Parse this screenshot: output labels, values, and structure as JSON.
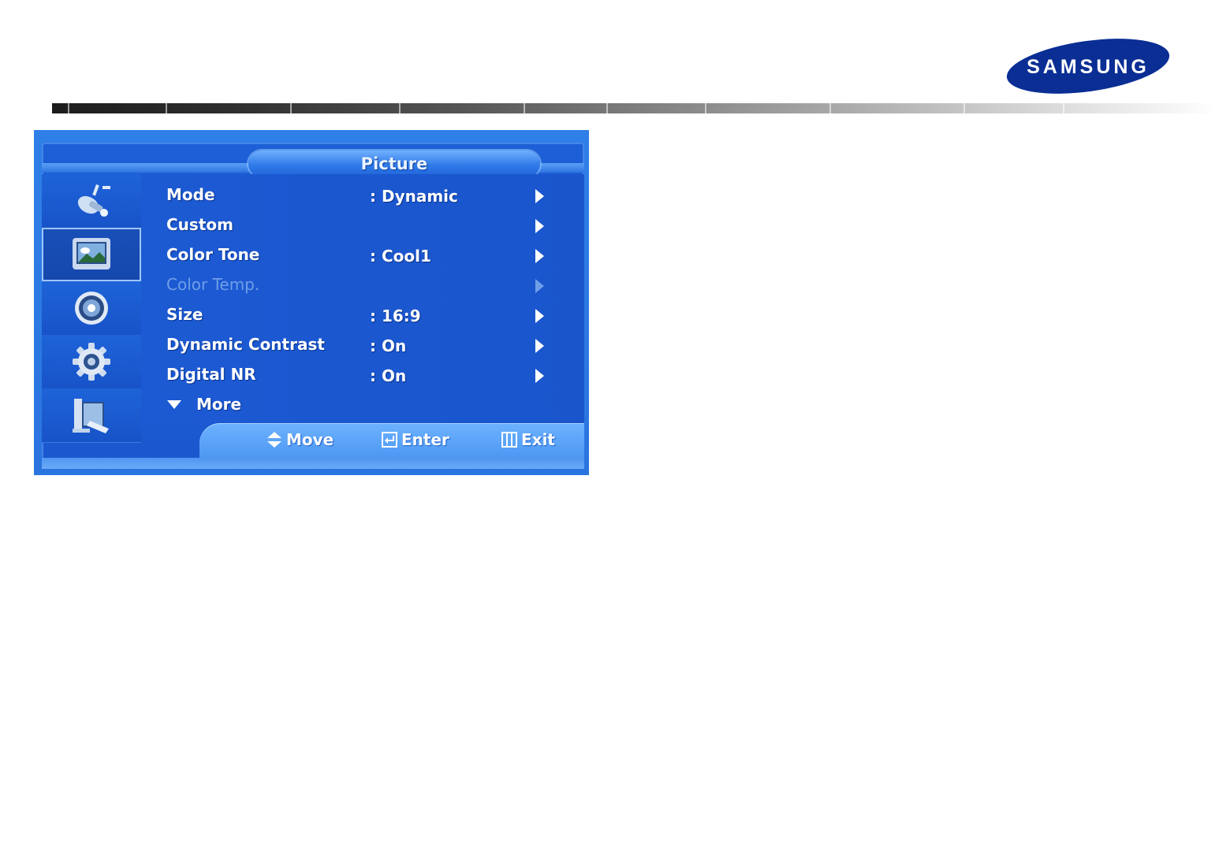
{
  "brand": {
    "logo_text": "SAMSUNG",
    "logo_color": "#0a2e94"
  },
  "osd": {
    "title": "Picture",
    "sidebar": [
      {
        "icon": "input-plug-icon"
      },
      {
        "icon": "picture-icon",
        "active": true
      },
      {
        "icon": "speaker-icon"
      },
      {
        "icon": "gear-icon"
      },
      {
        "icon": "support-icon"
      }
    ],
    "menu": [
      {
        "label": "Mode",
        "value": ": Dynamic",
        "enabled": true
      },
      {
        "label": "Custom",
        "value": "",
        "enabled": true
      },
      {
        "label": "Color Tone",
        "value": ": Cool1",
        "enabled": true
      },
      {
        "label": "Color Temp.",
        "value": "",
        "enabled": false
      },
      {
        "label": "Size",
        "value": ": 16:9",
        "enabled": true
      },
      {
        "label": "Dynamic Contrast",
        "value": ": On",
        "enabled": true
      },
      {
        "label": "Digital NR",
        "value": ": On",
        "enabled": true
      }
    ],
    "more_label": "More",
    "help": {
      "move": "Move",
      "enter": "Enter",
      "exit": "Exit"
    },
    "colors": {
      "panel_blue": "#1b58cf",
      "help_bar": "#5aa2f7",
      "disabled_text": "#6f9fe8"
    }
  }
}
